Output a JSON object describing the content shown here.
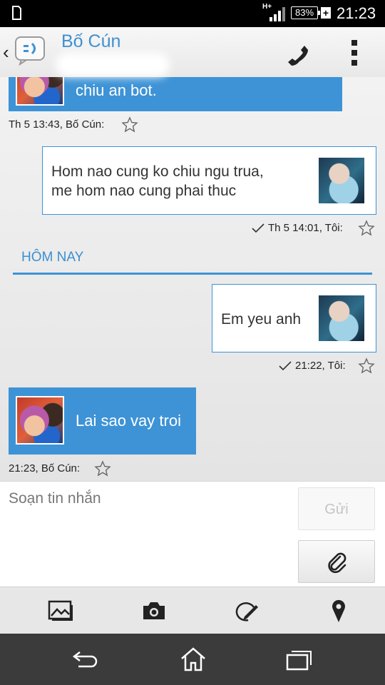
{
  "status": {
    "network": "H+",
    "battery": "83%",
    "time": "21:23"
  },
  "header": {
    "back_icon": "chevron-left-icon",
    "app_icon": "messaging-icon",
    "title": "Bố Cún",
    "call_icon": "phone-icon",
    "menu_icon": "overflow-menu-icon"
  },
  "messages": [
    {
      "direction": "in",
      "text": "chiu an bot.",
      "meta": "Th 5 13:43, Bố Cún:"
    },
    {
      "direction": "out",
      "lines": [
        "Hom nao cung ko chiu ngu trua,",
        "me hom nao cung phai thuc"
      ],
      "meta": "Th 5 14:01, Tôi:"
    },
    {
      "direction": "out",
      "text": "Em yeu anh",
      "meta": "21:22, Tôi:"
    },
    {
      "direction": "in",
      "text": "Lai sao vay troi",
      "meta": "21:23, Bố Cún:"
    }
  ],
  "section": {
    "label": "HÔM NAY"
  },
  "compose": {
    "placeholder": "Soạn tin nhắn",
    "send_label": "Gửi",
    "attach_icon": "paperclip-icon"
  },
  "toolbar": {
    "items": [
      "gallery-icon",
      "camera-icon",
      "draw-icon",
      "location-pin-icon"
    ]
  },
  "navbar": {
    "items": [
      "back-icon",
      "home-icon",
      "recent-apps-icon"
    ]
  },
  "colors": {
    "accent": "#3d93d6",
    "title": "#3f8fcf",
    "statusbar": "#000000",
    "navbar": "#3b3b3b"
  }
}
